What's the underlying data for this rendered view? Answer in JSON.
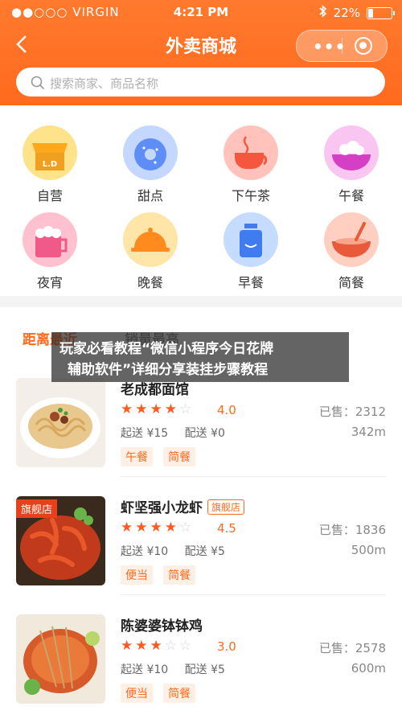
{
  "status": {
    "carrier": "●●○○○ VIRGIN",
    "time": "4:21 PM",
    "battery": "22%"
  },
  "navbar": {
    "title": "外卖商城",
    "capsule_dots": "•••"
  },
  "search": {
    "placeholder": "搜索商家、商品名称"
  },
  "categories": [
    {
      "label": "自营",
      "icon": "shop-awning-icon",
      "color": "#ffd766"
    },
    {
      "label": "甜点",
      "icon": "donut-icon",
      "color": "#bcd2ff"
    },
    {
      "label": "下午茶",
      "icon": "coffee-cup-icon",
      "color": "#ffb8b0"
    },
    {
      "label": "午餐",
      "icon": "rice-bowl-icon",
      "color": "#f7b8ee"
    },
    {
      "label": "夜宵",
      "icon": "beer-mug-icon",
      "color": "#ffb6c8"
    },
    {
      "label": "晚餐",
      "icon": "food-cloche-icon",
      "color": "#ffe09a"
    },
    {
      "label": "早餐",
      "icon": "milk-bottle-icon",
      "color": "#b8d4ff"
    },
    {
      "label": "简餐",
      "icon": "soup-bowl-icon",
      "color": "#ffc4b4"
    }
  ],
  "sort_tabs": {
    "distance": "距离最近",
    "sales": "销量最高"
  },
  "overlay": {
    "line1": "玩家必看教程“微信小程序今日花牌",
    "line2": "辅助软件”详细分享装挂步骤教程"
  },
  "shops": [
    {
      "name": "老成都面馆",
      "badge": "",
      "flag": "",
      "rating": 4,
      "score": "4.0",
      "sold": "已售：2312",
      "min": "起送 ¥15",
      "fee": "配送 ¥0",
      "distance": "342m",
      "tags": [
        "午餐",
        "简餐"
      ]
    },
    {
      "name": "虾坚强小龙虾",
      "badge": "旗舰店",
      "flag": "旗舰店",
      "rating": 4,
      "score": "4.5",
      "sold": "已售：1836",
      "min": "起送 ¥10",
      "fee": "配送 ¥5",
      "distance": "500m",
      "tags": [
        "便当",
        "简餐"
      ]
    },
    {
      "name": "陈婆婆钵钵鸡",
      "badge": "",
      "flag": "",
      "rating": 3,
      "score": "3.0",
      "sold": "已售：2578",
      "min": "起送 ¥10",
      "fee": "配送 ¥5",
      "distance": "600m",
      "tags": [
        "便当",
        "简餐"
      ]
    }
  ]
}
